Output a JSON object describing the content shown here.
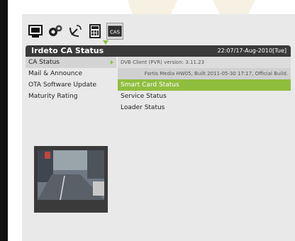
{
  "title": "Irdeto CA Status",
  "datetime": "22:07/17-Aug-2010[Tue]",
  "top_icons": [
    {
      "icon": "tv-icon"
    },
    {
      "icon": "settings-gears-icon"
    },
    {
      "icon": "satellite-dish-icon"
    },
    {
      "icon": "calculator-icon"
    },
    {
      "icon": "cas-icon",
      "label": "CAS",
      "active": true
    }
  ],
  "menu": {
    "items": [
      {
        "label": "CA Status",
        "selected": true
      },
      {
        "label": "Mail & Announce"
      },
      {
        "label": "OTA Software Update"
      },
      {
        "label": "Maturity Rating"
      }
    ]
  },
  "info": {
    "client_version": "DVB Client (PVR) version: 3.11.23",
    "build": "Fortis Media HW05, Built 2011-05-30 17:17, Official Build."
  },
  "status_items": [
    {
      "label": "Smart Card Status",
      "highlighted": true
    },
    {
      "label": "Service Status"
    },
    {
      "label": "Loader Status"
    }
  ],
  "colors": {
    "accent": "#8fbe3e",
    "titlebar": "#3a3a3a"
  }
}
